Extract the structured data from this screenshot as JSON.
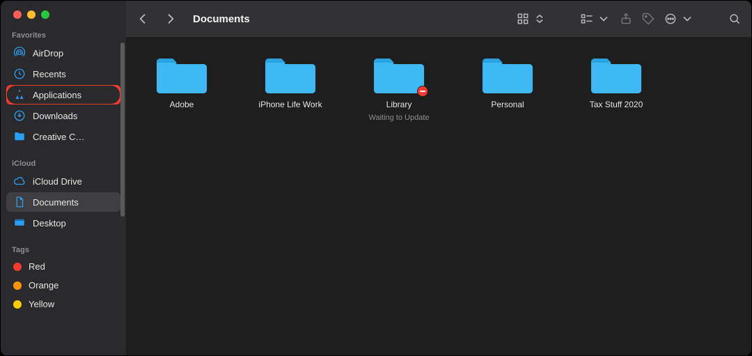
{
  "window_title": "Documents",
  "traffic": {
    "close": "#ff5f57",
    "min": "#febc2e",
    "max": "#28c840"
  },
  "sidebar": {
    "sections": [
      {
        "label": "Favorites",
        "items": [
          {
            "id": "airdrop",
            "icon": "airdrop",
            "label": "AirDrop"
          },
          {
            "id": "recents",
            "icon": "clock",
            "label": "Recents"
          },
          {
            "id": "applications",
            "icon": "apps",
            "label": "Applications",
            "highlighted": true
          },
          {
            "id": "downloads",
            "icon": "download",
            "label": "Downloads"
          },
          {
            "id": "creative",
            "icon": "folder",
            "label": "Creative C…"
          }
        ]
      },
      {
        "label": "iCloud",
        "items": [
          {
            "id": "icloud-drive",
            "icon": "cloud",
            "label": "iCloud Drive"
          },
          {
            "id": "documents",
            "icon": "doc",
            "label": "Documents",
            "selected": true
          },
          {
            "id": "desktop",
            "icon": "desktop",
            "label": "Desktop"
          }
        ]
      }
    ],
    "tags_label": "Tags",
    "tags": [
      {
        "label": "Red",
        "color": "#ff3b30"
      },
      {
        "label": "Orange",
        "color": "#ff9500"
      },
      {
        "label": "Yellow",
        "color": "#ffcc00"
      }
    ]
  },
  "folders": [
    {
      "name": "Adobe",
      "badge": null,
      "sub": null
    },
    {
      "name": "iPhone Life Work",
      "badge": null,
      "sub": null
    },
    {
      "name": "Library",
      "badge": "no-entry",
      "sub": "Waiting to Update"
    },
    {
      "name": "Personal",
      "badge": null,
      "sub": null
    },
    {
      "name": "Tax Stuff 2020",
      "badge": null,
      "sub": null
    }
  ],
  "icons": {
    "folder_color": "#3fb9f5"
  }
}
